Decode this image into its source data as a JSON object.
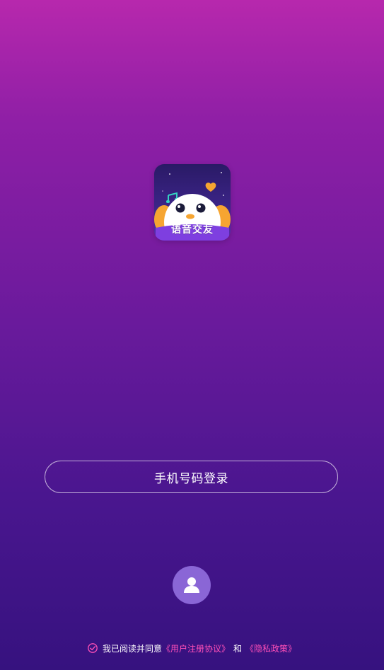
{
  "logo": {
    "text": "语音交友",
    "icon": "app-logo-bird"
  },
  "login": {
    "phone_label": "手机号码登录"
  },
  "guest": {
    "icon": "user-icon"
  },
  "agreement": {
    "prefix": "我已阅读并同意",
    "user_agreement": "《用户注册协议》",
    "and": "和",
    "privacy_policy": "《隐私政策》",
    "accent_color": "#ff4fb8"
  }
}
